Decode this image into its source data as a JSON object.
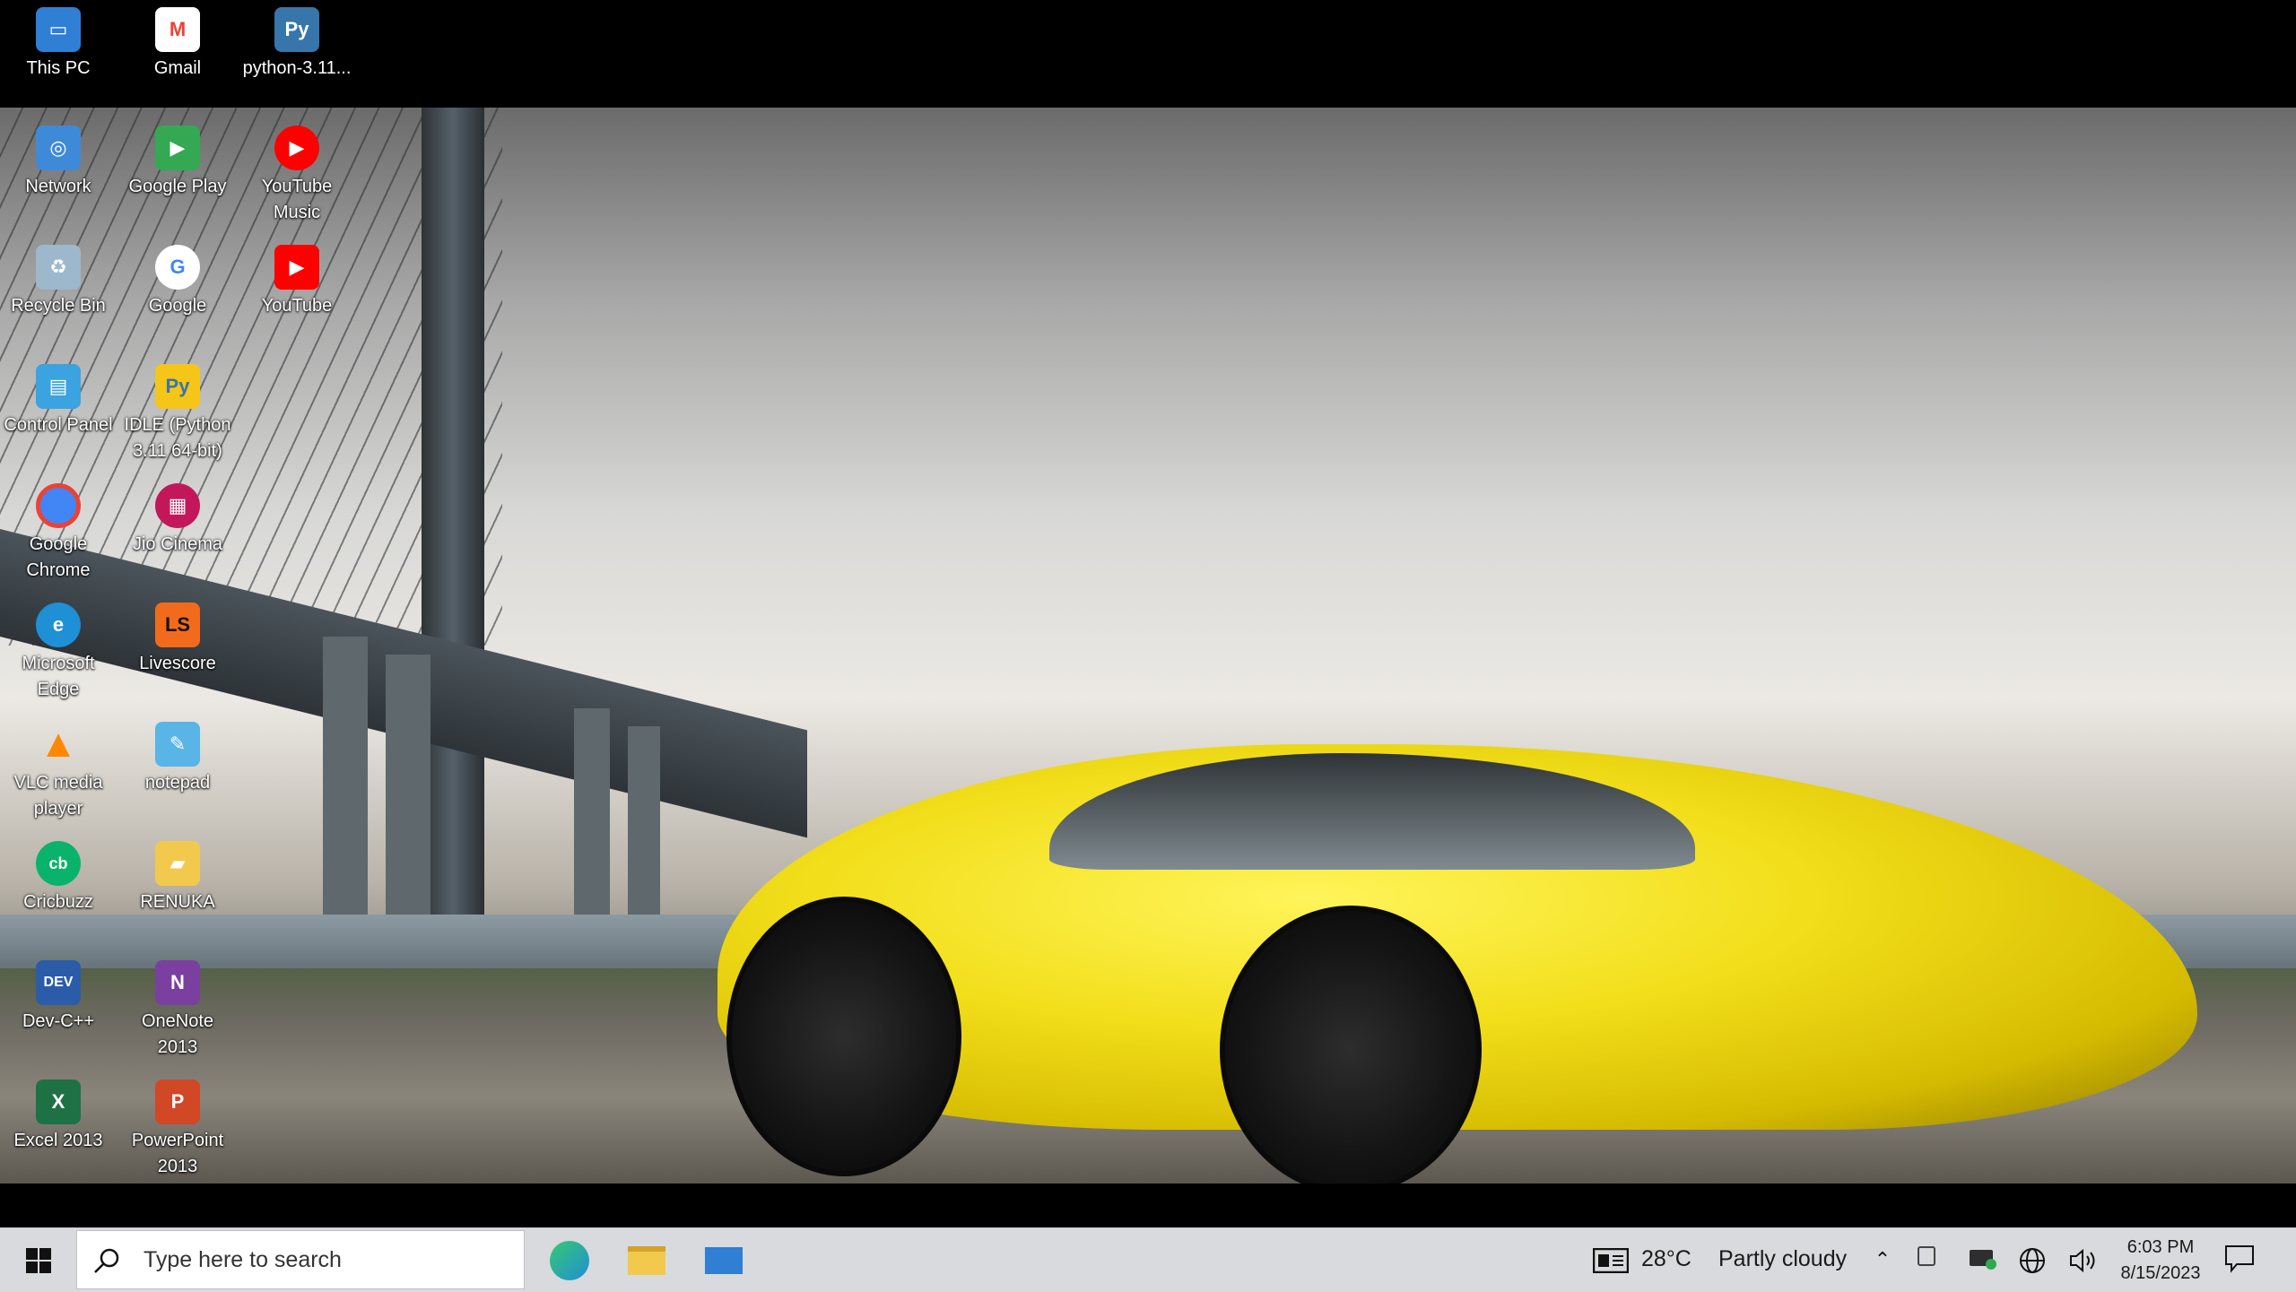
{
  "desktop": {
    "icons": [
      {
        "id": "this-pc",
        "label": "This PC",
        "icon": "computer-icon",
        "color": "#2f7fd4"
      },
      {
        "id": "gmail",
        "label": "Gmail",
        "icon": "gmail-icon",
        "color": "#ea4335"
      },
      {
        "id": "python-installer",
        "label": "python-3.11...",
        "icon": "python-icon",
        "color": "#3776ab"
      },
      {
        "id": "network",
        "label": "Network",
        "icon": "network-icon",
        "color": "#3f8ad8"
      },
      {
        "id": "google-play",
        "label": "Google Play",
        "icon": "google-play-icon",
        "color": "#34a853"
      },
      {
        "id": "youtube-music",
        "label": "YouTube Music",
        "icon": "youtube-music-icon",
        "color": "#ff0000"
      },
      {
        "id": "recycle-bin",
        "label": "Recycle Bin",
        "icon": "recycle-bin-icon",
        "color": "#9db7cc"
      },
      {
        "id": "google",
        "label": "Google",
        "icon": "google-icon",
        "color": "#4285f4"
      },
      {
        "id": "youtube",
        "label": "YouTube",
        "icon": "youtube-icon",
        "color": "#ff0000"
      },
      {
        "id": "control-panel",
        "label": "Control Panel",
        "icon": "control-panel-icon",
        "color": "#3aa3e0"
      },
      {
        "id": "idle-python",
        "label": "IDLE (Python 3.11 64-bit)",
        "icon": "idle-python-icon",
        "color": "#f5c518"
      },
      {
        "id": "google-chrome",
        "label": "Google Chrome",
        "icon": "chrome-icon",
        "color": "#4285f4"
      },
      {
        "id": "jio-cinema",
        "label": "Jio Cinema",
        "icon": "jio-cinema-icon",
        "color": "#c2185b"
      },
      {
        "id": "microsoft-edge",
        "label": "Microsoft Edge",
        "icon": "edge-icon",
        "color": "#1f8fd6"
      },
      {
        "id": "livescore",
        "label": "Livescore",
        "icon": "livescore-icon",
        "color": "#f26b1d"
      },
      {
        "id": "vlc",
        "label": "VLC media player",
        "icon": "vlc-icon",
        "color": "#ff8800"
      },
      {
        "id": "notepad",
        "label": "notepad",
        "icon": "notepad-icon",
        "color": "#58b5e6"
      },
      {
        "id": "cricbuzz",
        "label": "Cricbuzz",
        "icon": "cricbuzz-icon",
        "color": "#09b36b"
      },
      {
        "id": "renuka",
        "label": "RENUKA",
        "icon": "folder-icon",
        "color": "#f2c94c"
      },
      {
        "id": "dev-cpp",
        "label": "Dev-C++",
        "icon": "dev-cpp-icon",
        "color": "#2a5ca8"
      },
      {
        "id": "onenote",
        "label": "OneNote 2013",
        "icon": "onenote-icon",
        "color": "#7b3fa0"
      },
      {
        "id": "excel",
        "label": "Excel 2013",
        "icon": "excel-icon",
        "color": "#1e7145"
      },
      {
        "id": "powerpoint",
        "label": "PowerPoint 2013",
        "icon": "powerpoint-icon",
        "color": "#d24726"
      }
    ]
  },
  "taskbar": {
    "search_placeholder": "Type here to search",
    "pinned": [
      {
        "id": "edge",
        "icon": "edge-icon",
        "color": "#1f8fd6"
      },
      {
        "id": "file-explorer",
        "icon": "file-explorer-icon",
        "color": "#f2c94c"
      },
      {
        "id": "mail",
        "icon": "mail-icon",
        "color": "#2f7fd4"
      }
    ],
    "weather": {
      "temp": "28°C",
      "condition": "Partly cloudy"
    },
    "time": "6:03 PM",
    "date": "8/15/2023"
  }
}
